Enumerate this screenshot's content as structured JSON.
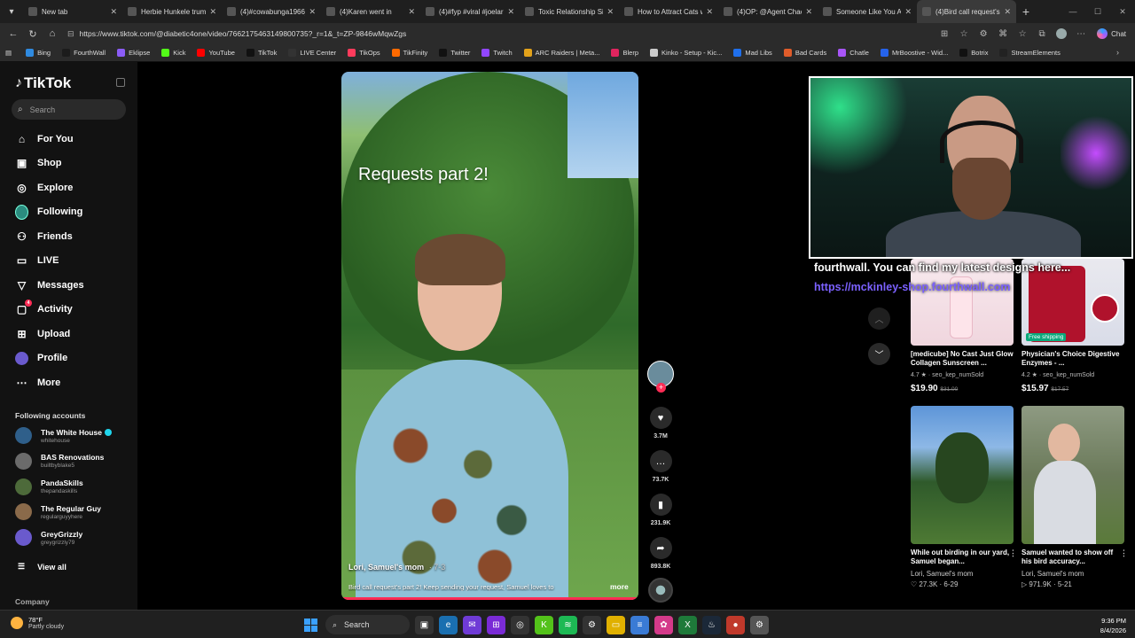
{
  "browser": {
    "tabs": [
      {
        "label": "New tab",
        "active": false
      },
      {
        "label": "Herbie Hunkele trump",
        "active": false
      },
      {
        "label": "(4)#cowabunga1966_",
        "active": false
      },
      {
        "label": "(4)Karen went in",
        "active": false
      },
      {
        "label": "(4)#fyp #viral #joelarp",
        "active": false
      },
      {
        "label": "Toxic Relationship Sign",
        "active": false
      },
      {
        "label": "How to Attract Cats wi",
        "active": false
      },
      {
        "label": "(4)OP: @Agent Chaos",
        "active": false
      },
      {
        "label": "Someone Like You Ad",
        "active": false
      },
      {
        "label": "(4)Bird call request's p",
        "active": true
      }
    ],
    "new_tab": "+",
    "url": "https://www.tiktok.com/@diabetic4one/video/7662175463149800735?_r=1&_t=ZP-9846wMqwZgs",
    "chat_label": "Chat",
    "bookmarks": [
      {
        "label": "Bing",
        "color": "#2f8ae0"
      },
      {
        "label": "FourthWall",
        "color": "#1c1c1c"
      },
      {
        "label": "Eklipse",
        "color": "#8b5cf6"
      },
      {
        "label": "Kick",
        "color": "#53fc18"
      },
      {
        "label": "YouTube",
        "color": "#ff0000"
      },
      {
        "label": "TikTok",
        "color": "#111111"
      },
      {
        "label": "LIVE Center",
        "color": "#333333"
      },
      {
        "label": "TikOps",
        "color": "#ff3b5c"
      },
      {
        "label": "TikFinity",
        "color": "#ff6a00"
      },
      {
        "label": "Twitter",
        "color": "#111111"
      },
      {
        "label": "Twitch",
        "color": "#9146ff"
      },
      {
        "label": "ARC Raiders | Meta...",
        "color": "#e3a21a"
      },
      {
        "label": "Blerp",
        "color": "#e0245e"
      },
      {
        "label": "Kinko - Setup - Kic...",
        "color": "#cccccc"
      },
      {
        "label": "Mad Libs",
        "color": "#1f6feb"
      },
      {
        "label": "Bad Cards",
        "color": "#e05c2a"
      },
      {
        "label": "Chatle",
        "color": "#a855f7"
      },
      {
        "label": "MrBoostive - Wid...",
        "color": "#2563eb"
      },
      {
        "label": "Botrix",
        "color": "#111111"
      },
      {
        "label": "StreamElements",
        "color": "#222222"
      }
    ]
  },
  "sidebar": {
    "logo": "TikTok",
    "search_placeholder": "Search",
    "menu": [
      {
        "label": "For You",
        "icon": "home-icon"
      },
      {
        "label": "Shop",
        "icon": "shop-icon"
      },
      {
        "label": "Explore",
        "icon": "compass-icon"
      },
      {
        "label": "Following",
        "icon": "following-avatar-icon"
      },
      {
        "label": "Friends",
        "icon": "friends-icon"
      },
      {
        "label": "LIVE",
        "icon": "live-icon"
      },
      {
        "label": "Messages",
        "icon": "messages-icon"
      },
      {
        "label": "Activity",
        "icon": "activity-icon",
        "badge": "4"
      },
      {
        "label": "Upload",
        "icon": "upload-icon"
      },
      {
        "label": "Profile",
        "icon": "profile-icon"
      },
      {
        "label": "More",
        "icon": "more-icon"
      }
    ],
    "following_title": "Following accounts",
    "accounts": [
      {
        "name": "The White House",
        "handle": "whitehouse",
        "verified": true,
        "color": "#2f5f8a"
      },
      {
        "name": "BAS Renovations",
        "handle": "builtbyblake5",
        "verified": false,
        "color": "#6b6b6b"
      },
      {
        "name": "PandaSkills",
        "handle": "thepandaskills",
        "verified": false,
        "color": "#4d6a3a"
      },
      {
        "name": "The Regular Guy",
        "handle": "regularguyyhere",
        "verified": false,
        "color": "#8a6a4a"
      },
      {
        "name": "GreyGrizzly",
        "handle": "greygrizzly79",
        "verified": false,
        "color": "#6a5acd"
      }
    ],
    "view_all": "View all",
    "company": "Company"
  },
  "video": {
    "title": "Requests part 2!",
    "author": "Lori, Samuel's mom",
    "author_time": "· 7-3",
    "description": "Bird call request's part 2! Keep sending your request, Samuel loves to",
    "more": "more"
  },
  "actions": {
    "likes": "3.7M",
    "comments": "73.7K",
    "saves": "231.9K",
    "shares": "893.8K"
  },
  "overlay": {
    "line1": "fourthwall. You can find my latest designs here...",
    "line2": "https://mckinley-shop.fourthwall.com"
  },
  "products": [
    {
      "title": "[medicube] No Cast Just Glow Collagen Sunscreen ...",
      "rating": "4.7 ★ · seo_kep_numSold",
      "price": "$19.90",
      "old_price": "$31.00",
      "free_shipping": ""
    },
    {
      "title": "Physician's Choice Digestive Enzymes - ...",
      "rating": "4.2 ★ · seo_kep_numSold",
      "price": "$15.97",
      "old_price": "$17.57",
      "free_shipping": "Free shipping"
    }
  ],
  "related_videos": [
    {
      "title": "While out birding in our yard, Samuel began...",
      "author": "Lori, Samuel's mom",
      "stats": "27.3K · 6-29"
    },
    {
      "title": "Samuel wanted to show off his bird accuracy...",
      "author": "Lori, Samuel's mom",
      "stats": "971.9K · 5-21"
    }
  ],
  "taskbar": {
    "weather_temp": "78°F",
    "weather_desc": "Partly cloudy",
    "search": "Search",
    "time": "9:36 PM",
    "date": "8/4/2026"
  }
}
